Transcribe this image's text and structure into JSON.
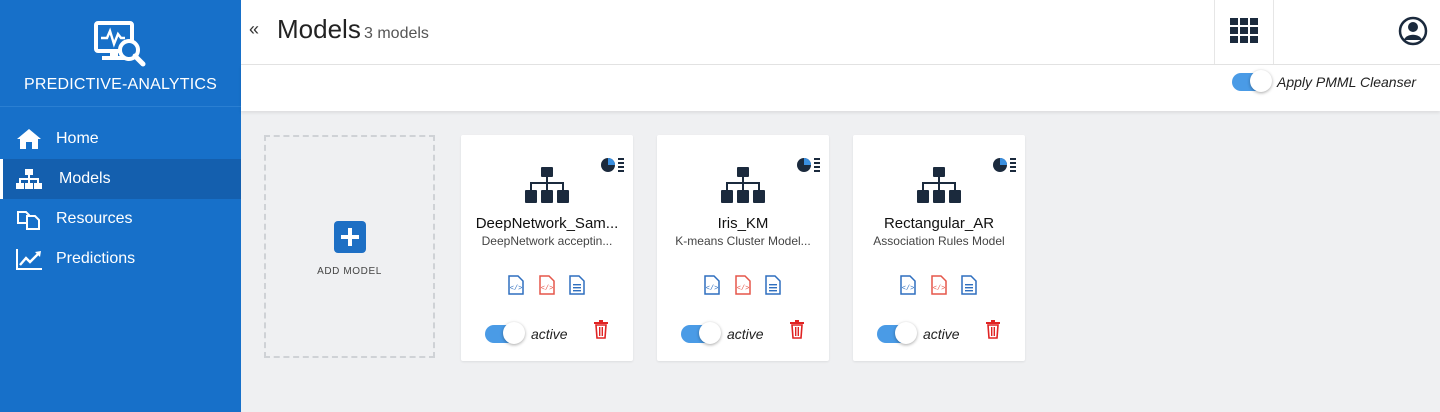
{
  "app": {
    "brand_name": "PREDICTIVE-ANALYTICS",
    "brand_icon": "monitor-analytics-icon",
    "colors": {
      "sidebar": "#1770c9",
      "sidebar_active": "#145fae",
      "accent": "#1d6fc4",
      "toggle_on": "#4a9be6",
      "danger": "#e02424"
    }
  },
  "sidebar": {
    "items": [
      {
        "label": "Home",
        "icon": "home-icon",
        "active": false
      },
      {
        "label": "Models",
        "icon": "sitemap-icon",
        "active": true
      },
      {
        "label": "Resources",
        "icon": "copy-icon",
        "active": false
      },
      {
        "label": "Predictions",
        "icon": "line-chart-icon",
        "active": false
      }
    ]
  },
  "header": {
    "collapse_symbol": "«",
    "title": "Models",
    "count_label": "3 models",
    "grid_icon": "apps-grid-icon",
    "user_icon": "user-circle-icon"
  },
  "toolbar": {
    "pmml_cleanser_label": "Apply PMML Cleanser",
    "pmml_cleanser_on": true
  },
  "add_model": {
    "label": "ADD MODEL",
    "icon": "plus-square-icon"
  },
  "models": [
    {
      "name": "DeepNetwork_Sam...",
      "description": "DeepNetwork acceptin...",
      "status": "active",
      "enabled": true
    },
    {
      "name": "Iris_KM",
      "description": "K-means Cluster Model...",
      "status": "active",
      "enabled": true
    },
    {
      "name": "Rectangular_AR",
      "description": "Association Rules Model",
      "status": "active",
      "enabled": true
    }
  ]
}
